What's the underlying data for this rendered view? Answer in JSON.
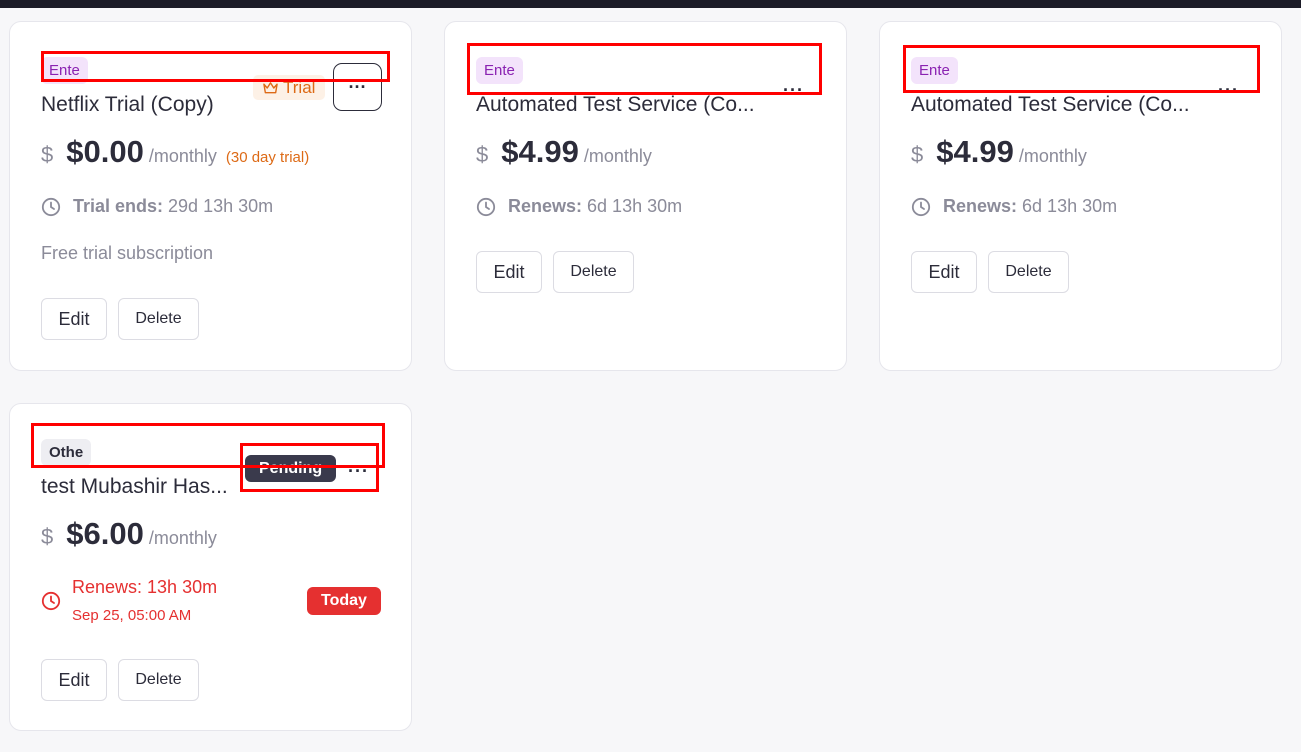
{
  "colors": {
    "accent_purple": "#8a22b2",
    "trial_orange": "#dd6a16",
    "danger_red": "#e53030",
    "pending_dark": "#3a3a4c"
  },
  "currency_symbol": "$",
  "cards": [
    {
      "category": "Ente",
      "title": "Netflix Trial (Copy)",
      "badge": "Trial",
      "badge_icon": "crown-icon",
      "menu_icon": "more-horizontal-icon",
      "amount": "$0.00",
      "period": "/monthly",
      "note": "(30 day trial)",
      "info_label": "Trial ends:",
      "info_value": "29d 13h 30m",
      "description": "Free trial subscription",
      "edit_label": "Edit",
      "delete_label": "Delete"
    },
    {
      "category": "Ente",
      "title": "Automated Test Service (Co...",
      "menu_icon": "more-horizontal-icon",
      "amount": "$4.99",
      "period": "/monthly",
      "info_label": "Renews:",
      "info_value": "6d 13h 30m",
      "edit_label": "Edit",
      "delete_label": "Delete"
    },
    {
      "category": "Ente",
      "title": "Automated Test Service (Co...",
      "menu_icon": "more-horizontal-icon",
      "amount": "$4.99",
      "period": "/monthly",
      "info_label": "Renews:",
      "info_value": "6d 13h 30m",
      "edit_label": "Edit",
      "delete_label": "Delete"
    },
    {
      "category": "Othe",
      "title": "test Mubashir Has...",
      "badge": "Pending",
      "menu_icon": "more-horizontal-icon",
      "amount": "$6.00",
      "period": "/monthly",
      "renew_line": "Renews: 13h 30m",
      "renew_date": "Sep 25, 05:00 AM",
      "renew_badge": "Today",
      "edit_label": "Edit",
      "delete_label": "Delete"
    }
  ]
}
